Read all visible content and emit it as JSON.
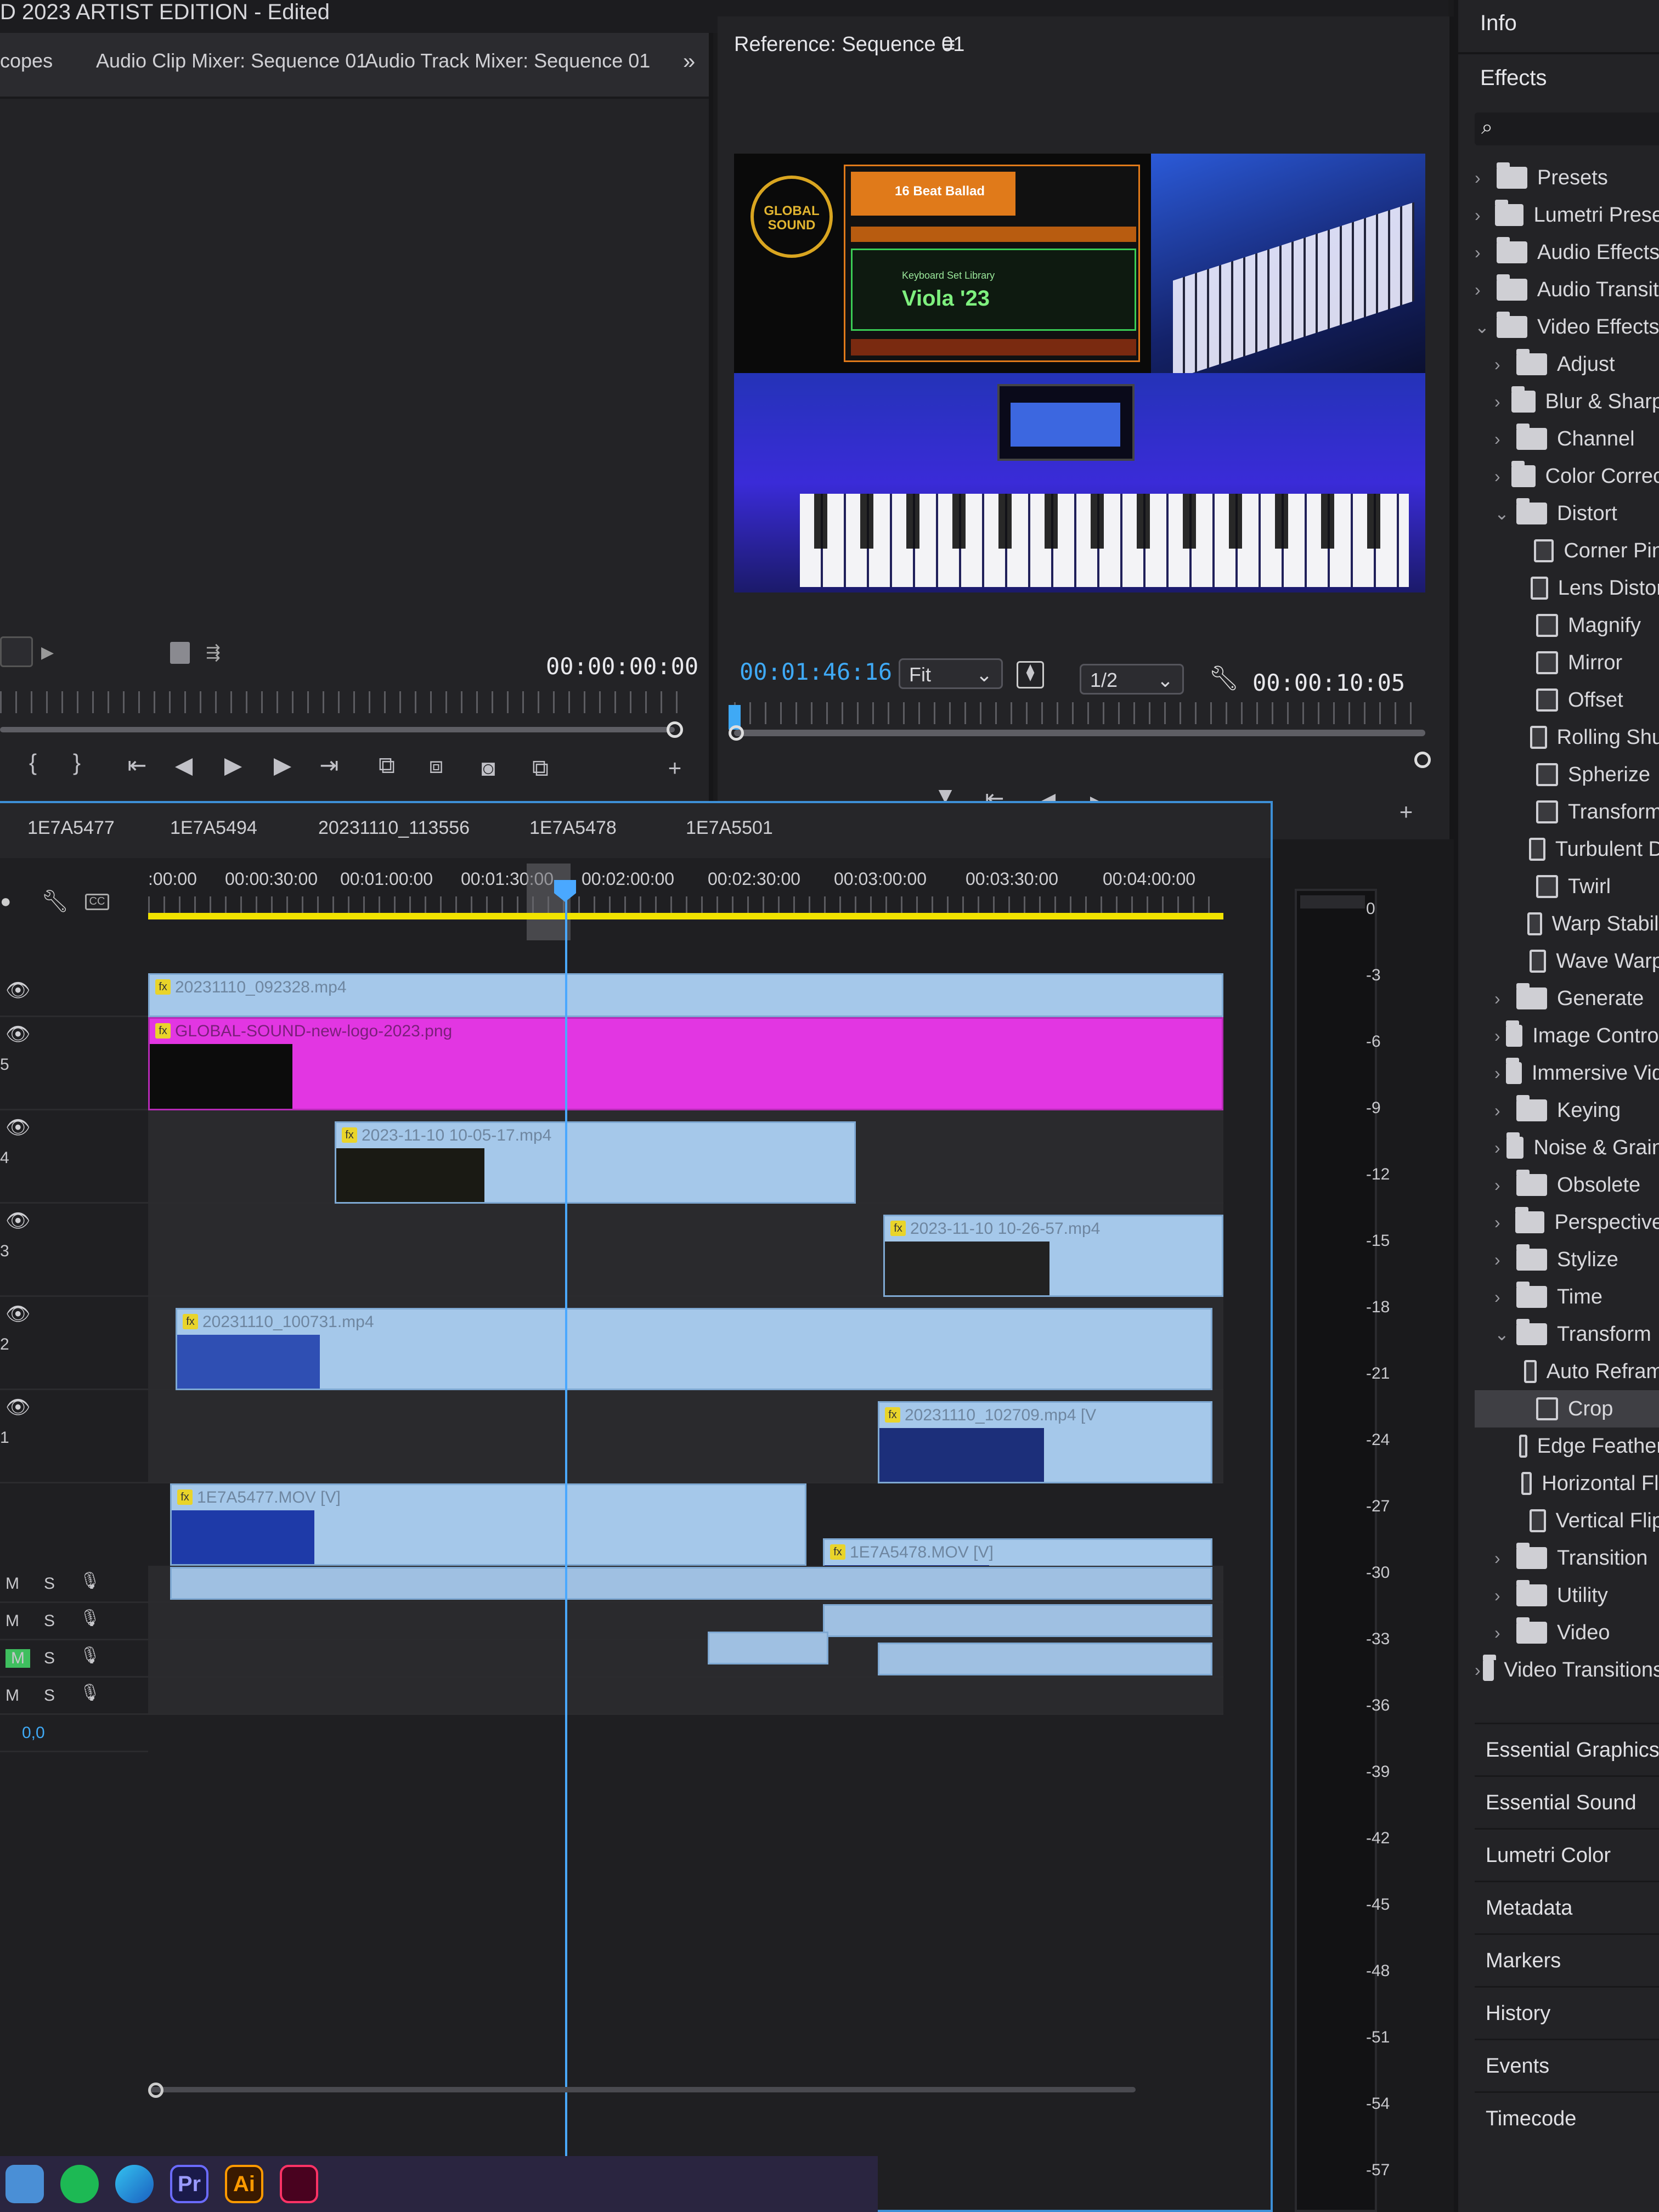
{
  "window": {
    "title": "D 2023 ARTIST EDITION - Edited"
  },
  "audio_panel": {
    "tabs": [
      "copes",
      "Audio Clip Mixer: Sequence 01",
      "Audio Track Mixer: Sequence 01"
    ],
    "overflow_icon": "chevron-double-right",
    "timecode": "00:00:00:00"
  },
  "reference_monitor": {
    "title": "Reference: Sequence 01",
    "playhead_timecode": "00:01:46:16",
    "fit_option": "Fit",
    "resolution_option": "1/2",
    "duration_timecode": "00:00:10:05",
    "video_overlay": {
      "logo_text": "GLOBAL SOUND",
      "screen_title": "16 Beat Ballad",
      "preset_name": "Viola '23",
      "library": "Keyboard Set Library"
    }
  },
  "effects_panel": {
    "info_label": "Info",
    "effects_label": "Effects",
    "search_placeholder": "",
    "tree": [
      {
        "label": "Presets",
        "type": "folder",
        "level": 0,
        "expanded": false,
        "special": true
      },
      {
        "label": "Lumetri Prese",
        "type": "folder",
        "level": 0,
        "expanded": false,
        "special": true
      },
      {
        "label": "Audio Effects",
        "type": "folder",
        "level": 0,
        "expanded": false
      },
      {
        "label": "Audio Transiti",
        "type": "folder",
        "level": 0,
        "expanded": false
      },
      {
        "label": "Video Effects",
        "type": "folder",
        "level": 0,
        "expanded": true
      },
      {
        "label": "Adjust",
        "type": "folder",
        "level": 1,
        "expanded": false
      },
      {
        "label": "Blur & Sharp",
        "type": "folder",
        "level": 1,
        "expanded": false
      },
      {
        "label": "Channel",
        "type": "folder",
        "level": 1,
        "expanded": false
      },
      {
        "label": "Color Correc",
        "type": "folder",
        "level": 1,
        "expanded": false
      },
      {
        "label": "Distort",
        "type": "folder",
        "level": 1,
        "expanded": true
      },
      {
        "label": "Corner Pin",
        "type": "effect",
        "level": 2
      },
      {
        "label": "Lens Distor",
        "type": "effect",
        "level": 2
      },
      {
        "label": "Magnify",
        "type": "effect",
        "level": 2
      },
      {
        "label": "Mirror",
        "type": "effect",
        "level": 2
      },
      {
        "label": "Offset",
        "type": "effect",
        "level": 2
      },
      {
        "label": "Rolling Shu",
        "type": "effect",
        "level": 2
      },
      {
        "label": "Spherize",
        "type": "effect",
        "level": 2
      },
      {
        "label": "Transform",
        "type": "effect",
        "level": 2
      },
      {
        "label": "Turbulent D",
        "type": "effect",
        "level": 2
      },
      {
        "label": "Twirl",
        "type": "effect",
        "level": 2
      },
      {
        "label": "Warp Stabili",
        "type": "effect",
        "level": 2
      },
      {
        "label": "Wave Warp",
        "type": "effect",
        "level": 2
      },
      {
        "label": "Generate",
        "type": "folder",
        "level": 1,
        "expanded": false
      },
      {
        "label": "Image Control",
        "type": "folder",
        "level": 1,
        "expanded": false
      },
      {
        "label": "Immersive Vid",
        "type": "folder",
        "level": 1,
        "expanded": false
      },
      {
        "label": "Keying",
        "type": "folder",
        "level": 1,
        "expanded": false
      },
      {
        "label": "Noise & Grain",
        "type": "folder",
        "level": 1,
        "expanded": false
      },
      {
        "label": "Obsolete",
        "type": "folder",
        "level": 1,
        "expanded": false
      },
      {
        "label": "Perspective",
        "type": "folder",
        "level": 1,
        "expanded": false
      },
      {
        "label": "Stylize",
        "type": "folder",
        "level": 1,
        "expanded": false
      },
      {
        "label": "Time",
        "type": "folder",
        "level": 1,
        "expanded": false
      },
      {
        "label": "Transform",
        "type": "folder",
        "level": 1,
        "expanded": true
      },
      {
        "label": "Auto Refram",
        "type": "effect",
        "level": 2
      },
      {
        "label": "Crop",
        "type": "effect",
        "level": 2,
        "selected": true
      },
      {
        "label": "Edge Feather",
        "type": "effect",
        "level": 2
      },
      {
        "label": "Horizontal Fli",
        "type": "effect",
        "level": 2
      },
      {
        "label": "Vertical Flip",
        "type": "effect",
        "level": 2
      },
      {
        "label": "Transition",
        "type": "folder",
        "level": 1,
        "expanded": false
      },
      {
        "label": "Utility",
        "type": "folder",
        "level": 1,
        "expanded": false
      },
      {
        "label": "Video",
        "type": "folder",
        "level": 1,
        "expanded": false
      },
      {
        "label": "Video Transitions",
        "type": "folder",
        "level": 0,
        "expanded": false
      }
    ],
    "panels": [
      "Essential Graphics",
      "Essential Sound",
      "Lumetri Color",
      "Metadata",
      "Markers",
      "History",
      "Events",
      "Timecode"
    ]
  },
  "timeline": {
    "sequence_tabs": [
      "1E7A5477",
      "1E7A5494",
      "20231110_113556",
      "1E7A5478",
      "1E7A5501"
    ],
    "ruler_labels": [
      ":00:00",
      "00:00:30:00",
      "00:01:00:00",
      "00:01:30:00",
      "00:02:00:00",
      "00:02:30:00",
      "00:03:00:00",
      "00:03:30:00",
      "00:04:00:00"
    ],
    "track_labels": [
      "",
      "5",
      "4",
      "3",
      "2",
      "1"
    ],
    "audio_controls": {
      "mute": "M",
      "solo": "S"
    },
    "master_level": "0,0",
    "clips": {
      "v6": "20231110_092328.mp4",
      "v5": "GLOBAL-SOUND-new-logo-2023.png",
      "v4": "2023-11-10 10-05-17.mp4",
      "v3": "2023-11-10 10-26-57.mp4",
      "v2a": "20231110_100731.mp4",
      "v2b": "20231110_102709.mp4 [V",
      "v1a": "1E7A5477.MOV [V]",
      "v1b": "1E7A5478.MOV [V]"
    }
  },
  "meter": {
    "db_labels": [
      "0",
      "-3",
      "-6",
      "-9",
      "-12",
      "-15",
      "-18",
      "-21",
      "-24",
      "-27",
      "-30",
      "-33",
      "-36",
      "-39",
      "-42",
      "-45",
      "-48",
      "-51",
      "-54",
      "-57"
    ]
  },
  "taskbar": {
    "apps": [
      "files",
      "spotify",
      "edge",
      "premiere",
      "illustrator",
      "indesign"
    ],
    "premiere_label": "Pr",
    "illustrator_label": "Ai"
  },
  "colors": {
    "accent_blue": "#3fa9f5",
    "work_area_yellow": "#f1e300",
    "clip_blue": "#a5c8ea",
    "clip_pink": "#e236e2"
  }
}
